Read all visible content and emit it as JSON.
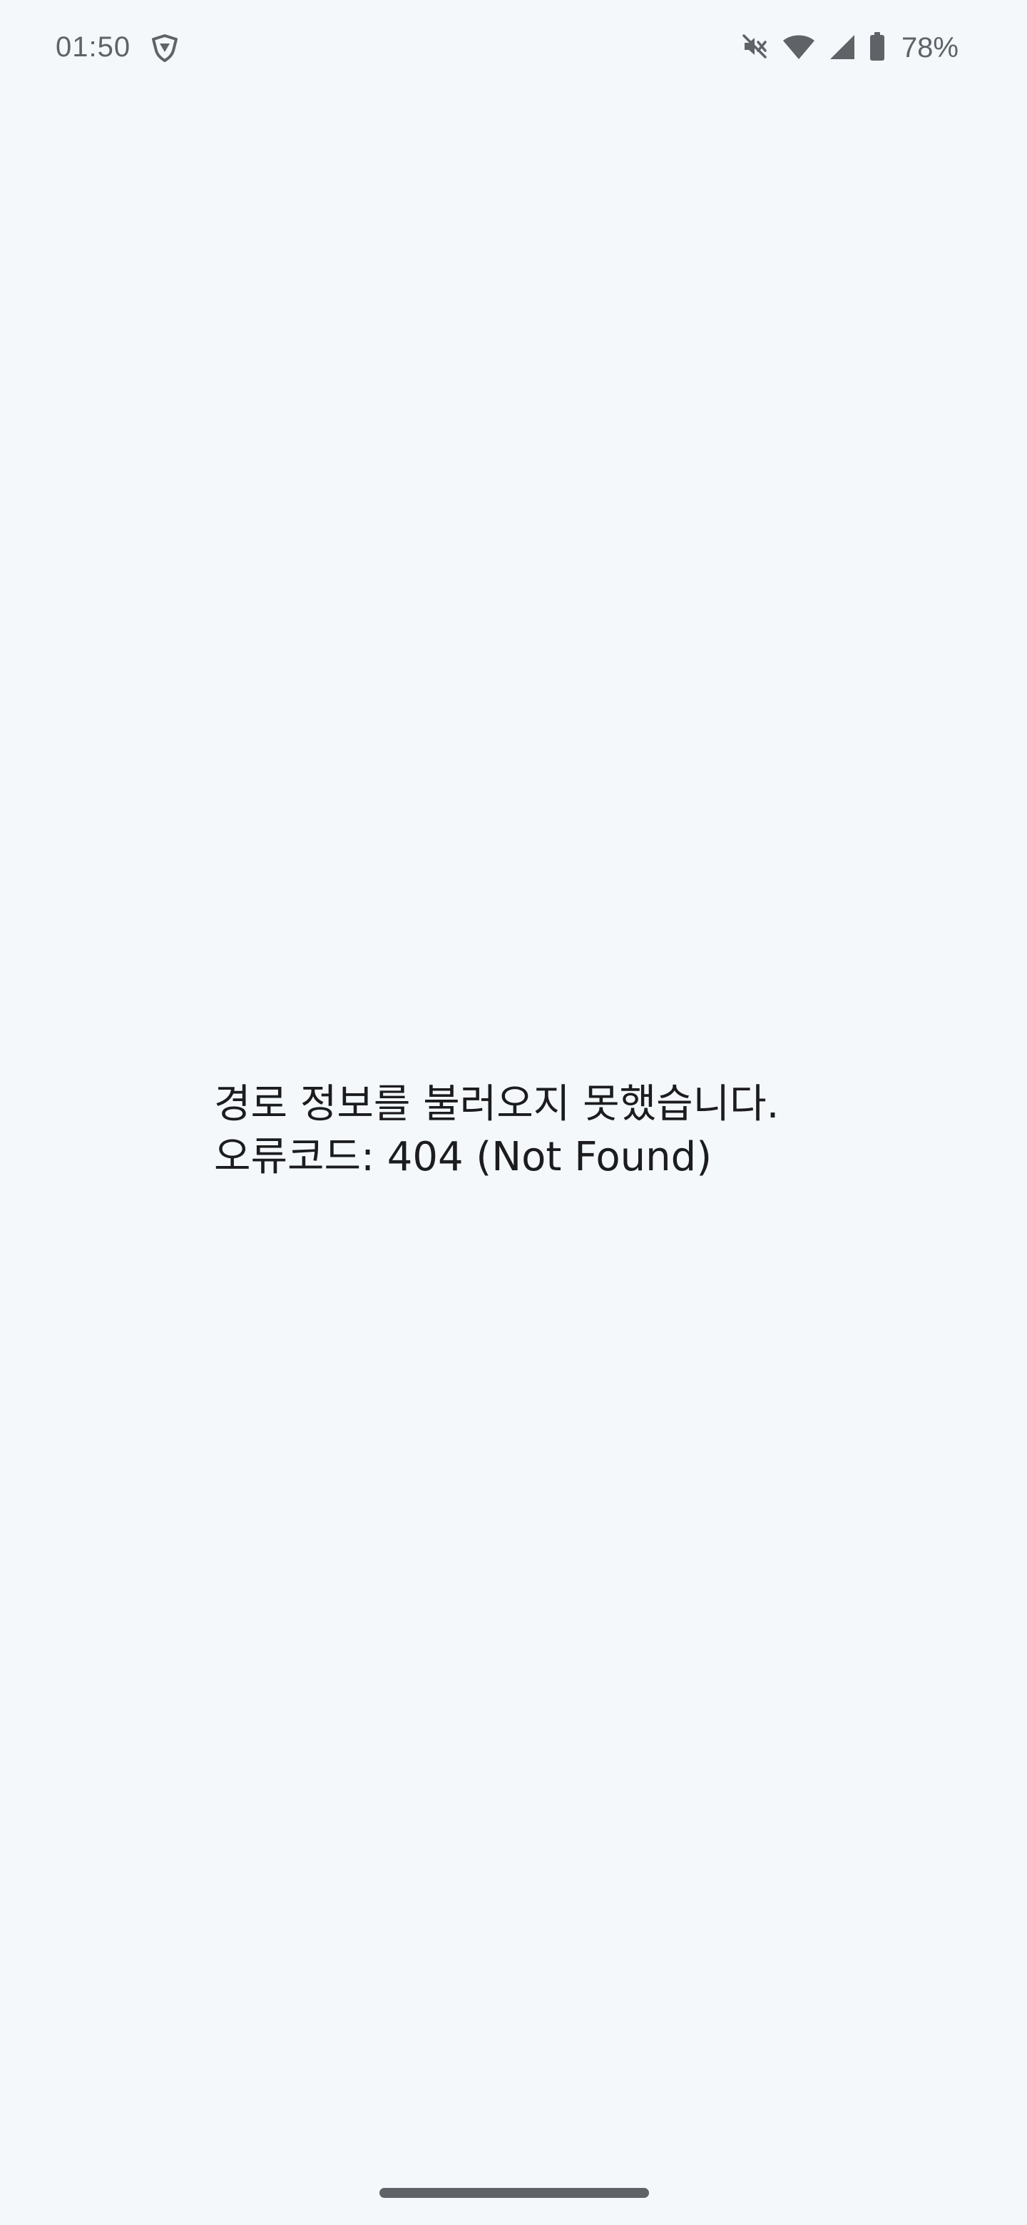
{
  "status_bar": {
    "time": "01:50",
    "battery_percent": "78%",
    "icons": [
      "vpn-shield-icon",
      "mute-icon",
      "wifi-icon",
      "cellular-signal-icon",
      "battery-icon"
    ],
    "icon_color": "#5f6368"
  },
  "error": {
    "line1": "경로 정보를 불러오지 못했습니다.",
    "line2": "오류코드: 404 (Not Found)"
  },
  "colors": {
    "background": "#f4f8fb",
    "text": "#1c1c1e",
    "nav_handle": "#5f6266"
  }
}
